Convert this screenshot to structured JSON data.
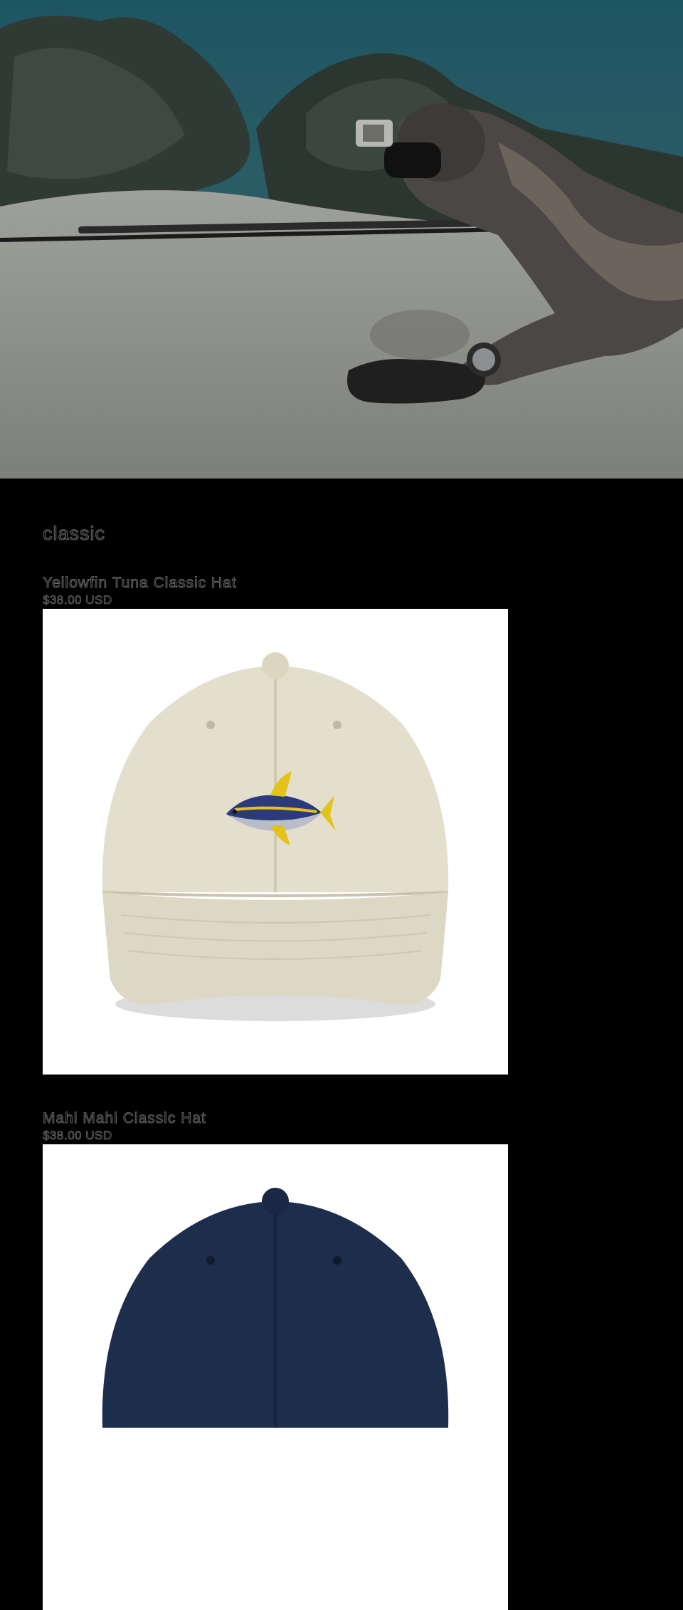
{
  "hero": {
    "image": "spearfisher-underwater-photo",
    "colors": {
      "water": "#2a5b68",
      "sand": "#8f918b",
      "suit": "#4a4744"
    }
  },
  "collection": {
    "title": "classic",
    "products": [
      {
        "name": "Yellowfin Tuna Classic Hat",
        "price": "$38.00 USD",
        "image": "beige-cap-with-yellowfin-tuna-embroidery",
        "cap_color": "#e4dfcc"
      },
      {
        "name": "Mahi Mahi Classic Hat",
        "price": "$38.00 USD",
        "image": "navy-cap-with-mahi-mahi-embroidery",
        "cap_color": "#1d2d4c"
      }
    ]
  }
}
